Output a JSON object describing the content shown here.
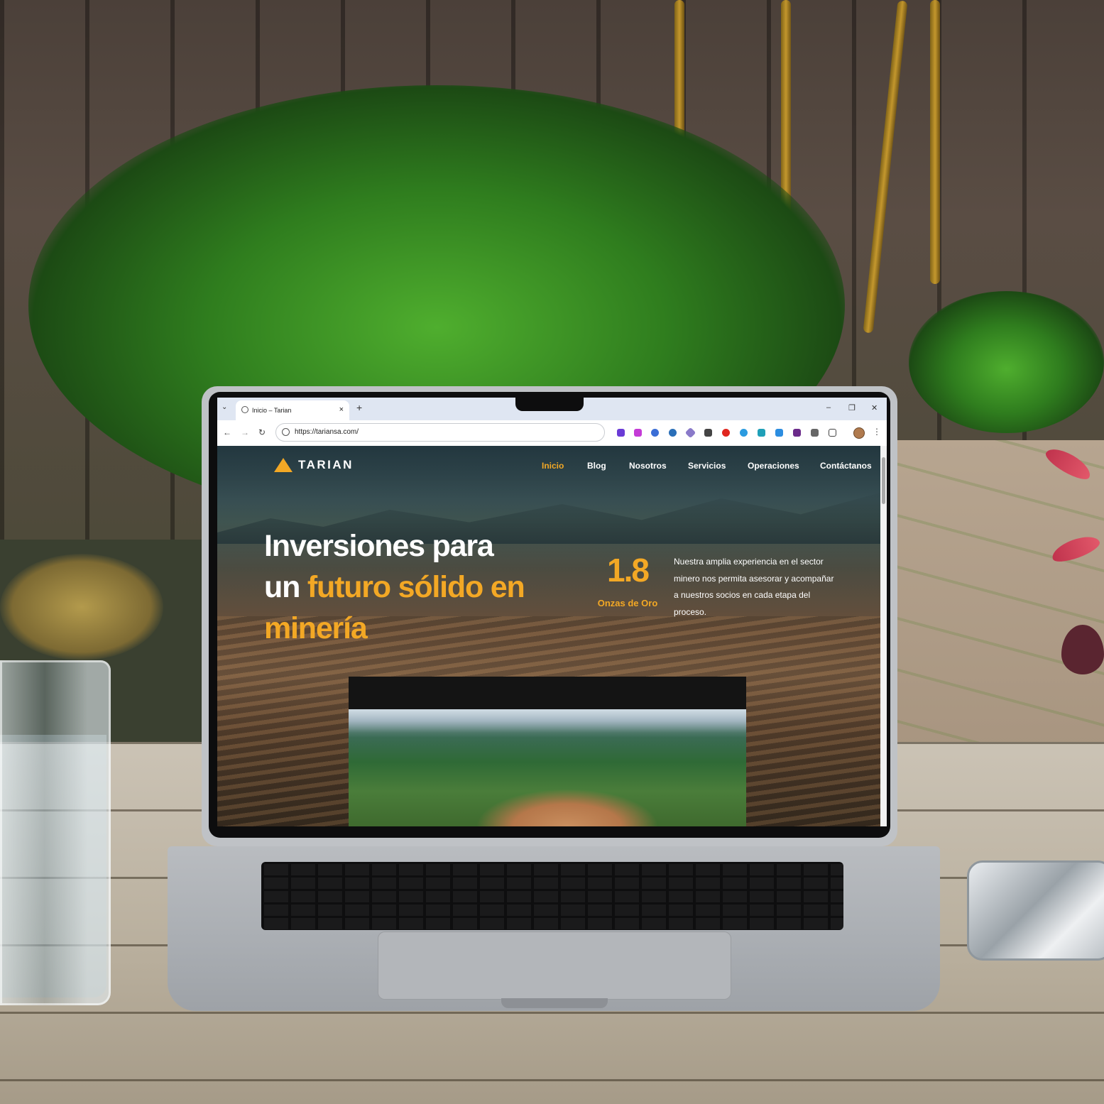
{
  "browser": {
    "tab_title": "Inicio – Tarian",
    "new_tab": "+",
    "tab_close": "×",
    "tab_list": "⌄",
    "url": "https://tariansa.com/",
    "back": "←",
    "forward": "→",
    "reload": "↻",
    "menu": "⋮",
    "window_controls": {
      "minimize": "–",
      "restore": "❐",
      "close": "✕"
    }
  },
  "site": {
    "logo_text": "TARIAN",
    "nav": [
      {
        "label": "Inicio",
        "active": true
      },
      {
        "label": "Blog"
      },
      {
        "label": "Nosotros"
      },
      {
        "label": "Servicios"
      },
      {
        "label": "Operaciones"
      },
      {
        "label": "Contáctanos"
      }
    ],
    "hero": {
      "line1": "Inversiones para",
      "line2_plain": "un ",
      "line2_accent": "futuro sólido en",
      "line3_accent": "minería"
    },
    "stat": {
      "value": "1.8",
      "label": "Onzas de Oro"
    },
    "description": "Nuestra amplia experiencia en el sector minero nos permita asesorar y acompañar a nuestros socios en cada etapa del proceso."
  },
  "colors": {
    "accent": "#f3a825",
    "text": "#ffffff",
    "tab_strip": "#dfe6f2"
  }
}
